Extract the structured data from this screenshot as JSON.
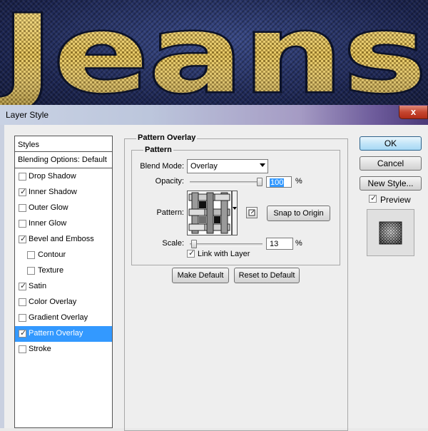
{
  "banner": {
    "text": "Jeans"
  },
  "window": {
    "title": "Layer Style",
    "close_glyph": "x"
  },
  "styles_panel": {
    "header": "Styles",
    "items": [
      {
        "label": "Blending Options: Default",
        "checkbox": false
      },
      {
        "label": "Drop Shadow",
        "checkbox": true,
        "checked": false
      },
      {
        "label": "Inner Shadow",
        "checkbox": true,
        "checked": true
      },
      {
        "label": "Outer Glow",
        "checkbox": true,
        "checked": false
      },
      {
        "label": "Inner Glow",
        "checkbox": true,
        "checked": false
      },
      {
        "label": "Bevel and Emboss",
        "checkbox": true,
        "checked": true
      },
      {
        "label": "Contour",
        "checkbox": true,
        "checked": false,
        "indent": true
      },
      {
        "label": "Texture",
        "checkbox": true,
        "checked": false,
        "indent": true
      },
      {
        "label": "Satin",
        "checkbox": true,
        "checked": true
      },
      {
        "label": "Color Overlay",
        "checkbox": true,
        "checked": false
      },
      {
        "label": "Gradient Overlay",
        "checkbox": true,
        "checked": false
      },
      {
        "label": "Pattern Overlay",
        "checkbox": true,
        "checked": true,
        "selected": true
      },
      {
        "label": "Stroke",
        "checkbox": true,
        "checked": false
      }
    ]
  },
  "pattern_overlay": {
    "section_title": "Pattern Overlay",
    "group_title": "Pattern",
    "blend_mode_label": "Blend Mode:",
    "blend_mode_value": "Overlay",
    "opacity_label": "Opacity:",
    "opacity_value": "100",
    "opacity_unit": "%",
    "opacity_level": 1.0,
    "pattern_label": "Pattern:",
    "snap_to_origin": "Snap to Origin",
    "scale_label": "Scale:",
    "scale_value": "13",
    "scale_unit": "%",
    "link_with_layer": "Link with Layer",
    "link_checked": true,
    "make_default": "Make Default",
    "reset_to_default": "Reset to Default"
  },
  "side_buttons": {
    "ok": "OK",
    "cancel": "Cancel",
    "new_style": "New Style...",
    "preview_label": "Preview",
    "preview_checked": true
  },
  "icons": {
    "close": "close-icon",
    "dropdown": "chevron-down-icon",
    "new_preset": "new-preset-icon",
    "check": "check-icon"
  },
  "colors": {
    "selection": "#3399ff",
    "banner_background": "#1e2a55",
    "jeans_gold": "#c9a544"
  }
}
